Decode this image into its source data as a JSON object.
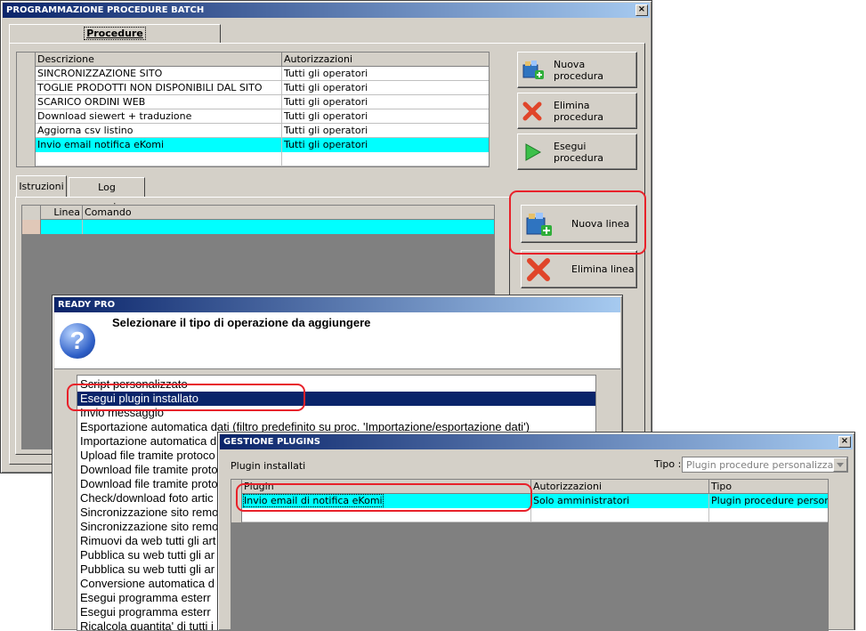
{
  "main_window": {
    "title": "PROGRAMMAZIONE PROCEDURE BATCH",
    "close_glyph": "×",
    "tab_procedure": "Procedure",
    "proc_grid": {
      "headers": [
        "Descrizione",
        "Autorizzazioni"
      ],
      "rows": [
        [
          "SINCRONIZZAZIONE SITO",
          "Tutti gli operatori"
        ],
        [
          "TOGLIE PRODOTTI NON DISPONIBILI DAL SITO",
          "Tutti gli operatori"
        ],
        [
          "SCARICO ORDINI WEB",
          "Tutti gli operatori"
        ],
        [
          "Download siewert + traduzione",
          "Tutti gli operatori"
        ],
        [
          "Aggiorna csv listino",
          "Tutti gli operatori"
        ],
        [
          "Invio email notifica eKomi",
          "Tutti gli operatori"
        ]
      ]
    },
    "buttons": {
      "nuova_procedura": "Nuova procedura",
      "elimina_procedura": "Elimina procedura",
      "esegui_procedura": "Esegui procedura",
      "nuova_linea": "Nuova linea",
      "elimina_linea": "Elimina linea"
    },
    "subtabs": {
      "istruzioni": "Istruzioni",
      "log": "Log esecuzione"
    },
    "lines_grid": {
      "headers": [
        "Linea",
        "Comando"
      ]
    }
  },
  "ready_pro_dialog": {
    "title": "READY PRO",
    "question_glyph": "?",
    "heading": "Selezionare il tipo di operazione da aggiungere",
    "options": [
      "Script personalizzato",
      "Esegui plugin installato",
      "Invio messaggio",
      "Esportazione automatica dati (filtro predefinito su proc. 'Importazione/esportazione dati')",
      "Importazione automatica d",
      "Upload file tramite protoco",
      "Download file tramite proto",
      "Download file tramite proto",
      "Check/download foto artic",
      "Sincronizzazione sito remo",
      "Sincronizzazione sito remo",
      "Rimuovi da web tutti gli art",
      "Pubblica su web tutti gli ar",
      "Pubblica su web tutti gli ar",
      "Conversione automatica d",
      "Esegui programma esterr",
      "Esegui programma esterr",
      "Ricalcola quantita' di tutti i"
    ],
    "selected_index": 1
  },
  "plugins_window": {
    "title": "GESTIONE PLUGINS",
    "close_glyph": "×",
    "label_installed": "Plugin installati",
    "tipo_label": "Tipo :",
    "tipo_value": "Plugin procedure personalizzate",
    "grid": {
      "headers": [
        "Plugin",
        "Autorizzazioni",
        "Tipo"
      ],
      "rows": [
        [
          "Invio email di notifica eKomi",
          "Solo amministratori",
          "Plugin procedure person..."
        ]
      ]
    }
  },
  "colors": {
    "selection": "#00ffff",
    "highlight_box": "#e8212a",
    "list_selection": "#0a246a"
  },
  "icons": [
    "add-procedure-icon",
    "delete-x-icon",
    "play-icon",
    "add-line-icon",
    "question-icon",
    "dropdown-arrow-icon"
  ]
}
